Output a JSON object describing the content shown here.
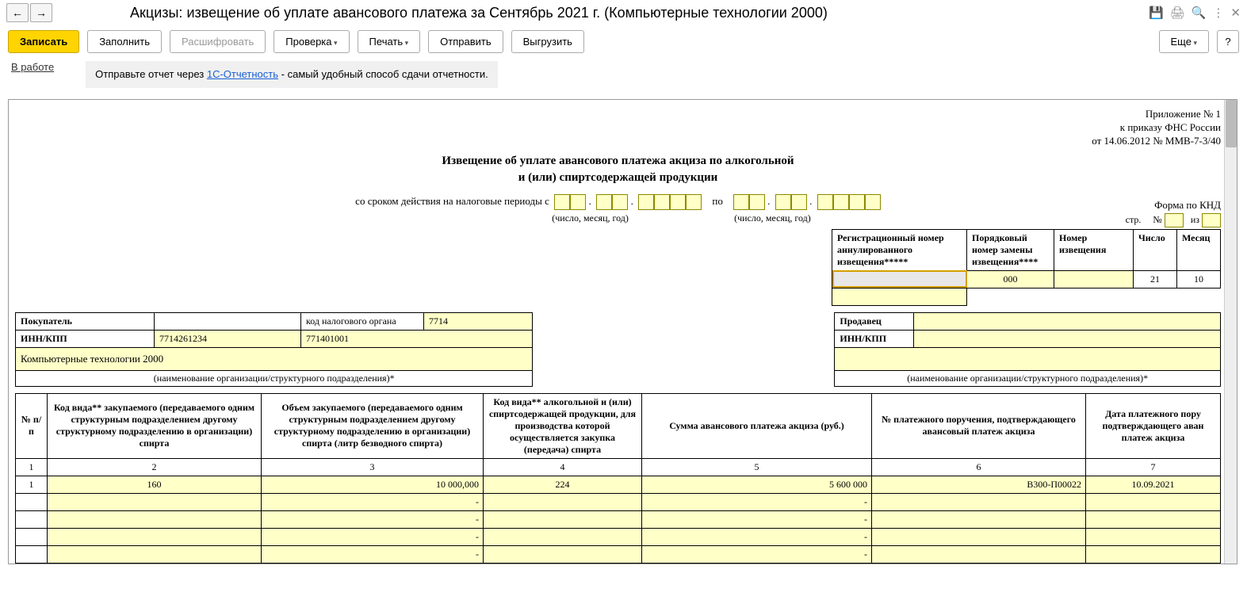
{
  "title": "Акцизы: извещение об уплате авансового платежа за Сентябрь 2021 г. (Компьютерные технологии 2000)",
  "toolbar": {
    "save": "Записать",
    "fill": "Заполнить",
    "decode": "Расшифровать",
    "check": "Проверка",
    "print": "Печать",
    "send": "Отправить",
    "export": "Выгрузить",
    "more": "Еще",
    "help": "?"
  },
  "status": {
    "label": "В работе",
    "hint_before": "Отправьте отчет через ",
    "hint_link": "1С-Отчетность",
    "hint_after": " - самый удобный способ сдачи отчетности."
  },
  "appendix": {
    "line1": "Приложение № 1",
    "line2": "к приказу ФНС России",
    "line3": "от  14.06.2012 № ММВ-7-3/40"
  },
  "doc_title1": "Извещение об уплате авансового платежа акциза по алкогольной",
  "doc_title2": "и (или) спиртсодержащей продукции",
  "period_prefix": "со сроком действия на налоговые периоды с",
  "period_to": "по",
  "period_caption": "(число, месяц, год)",
  "knd": "Форма по КНД",
  "page_str": "стр.",
  "page_no": "№",
  "page_iz": "из",
  "reg_headers": {
    "h1": "Регистрационный номер аннулированного извещения*****",
    "h2": "Порядковый номер замены извещения****",
    "h3": "Номер извещения",
    "h4": "Число",
    "h5": "Месяц"
  },
  "reg_row": {
    "c2": "000",
    "c4": "21",
    "c5": "10"
  },
  "buyer": {
    "label": "Покупатель",
    "tax_code_label": "код налогового органа",
    "tax_code": "7714",
    "innkpp_label": "ИНН/КПП",
    "inn": "7714261234",
    "kpp": "771401001",
    "org_name": "Компьютерные технологии 2000",
    "org_caption": "(наименование организации/структурного подразделения)*"
  },
  "seller": {
    "label": "Продавец",
    "innkpp_label": "ИНН/КПП",
    "org_caption": "(наименование организации/структурного подразделения)*"
  },
  "cols": {
    "c1": "№ п/п",
    "c2": "Код вида** закупаемого (передаваемого одним структурным подразделением другому структурному подразделению в организации) спирта",
    "c3": "Объем закупаемого (передаваемого одним структурным подразделением другому структурному подразделению в организации) спирта\n(литр безводного спирта)",
    "c4": "Код вида** алкогольной и (или) спиртсодержащей продукции, для производства которой осуществляется закупка (передача) спирта",
    "c5": "Сумма авансового платежа акциза (руб.)",
    "c6": "№ платежного поручения, подтверждающего авансовый платеж акциза",
    "c7": "Дата  платежного пору подтверждающего аван платеж акциза"
  },
  "colnums": {
    "c1": "1",
    "c2": "2",
    "c3": "3",
    "c4": "4",
    "c5": "5",
    "c6": "6",
    "c7": "7"
  },
  "row1": {
    "n": "1",
    "code_in": "160",
    "volume": "10 000,000",
    "code_out": "224",
    "sum": "5 600 000",
    "payno": "В300-П00022",
    "paydate": "10.09.2021"
  },
  "dash": "-"
}
